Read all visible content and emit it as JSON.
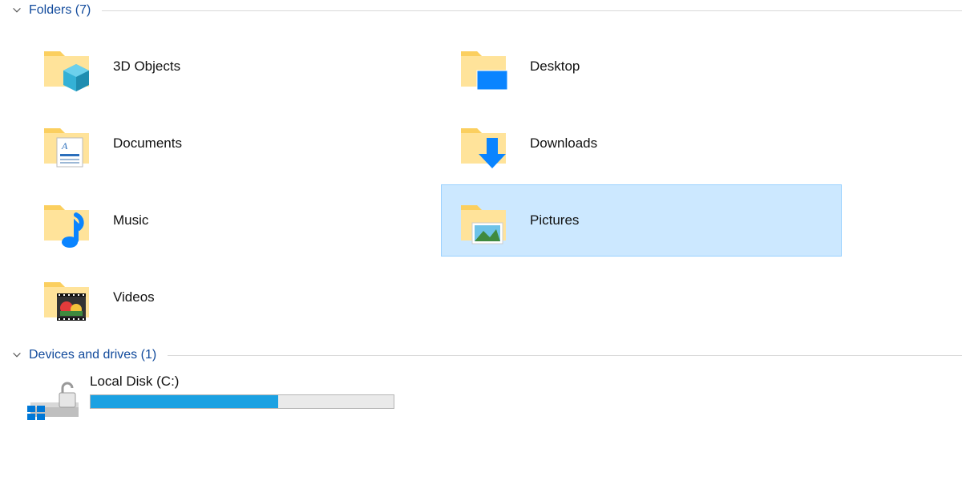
{
  "sections": {
    "folders": {
      "header": "Folders (7)"
    },
    "drives": {
      "header": "Devices and drives (1)"
    }
  },
  "folders": [
    {
      "name": "3D Objects",
      "icon": "3d",
      "selected": false
    },
    {
      "name": "Desktop",
      "icon": "desktop",
      "selected": false
    },
    {
      "name": "Documents",
      "icon": "documents",
      "selected": false
    },
    {
      "name": "Downloads",
      "icon": "downloads",
      "selected": false
    },
    {
      "name": "Music",
      "icon": "music",
      "selected": false
    },
    {
      "name": "Pictures",
      "icon": "pictures",
      "selected": true
    },
    {
      "name": "Videos",
      "icon": "videos",
      "selected": false
    }
  ],
  "drive": {
    "label": "Local Disk (C:)",
    "usage_percent": 62
  }
}
